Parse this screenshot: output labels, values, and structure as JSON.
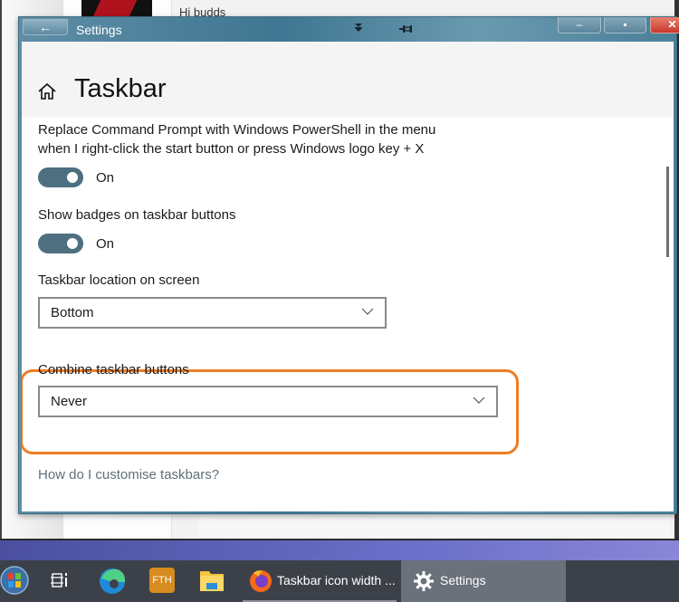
{
  "background": {
    "post_text": "Hi budds"
  },
  "window": {
    "title": "Settings",
    "back_label": "←",
    "icons": [
      "double-chevron-down-icon",
      "pin-icon"
    ],
    "controls": {
      "minimize": "–",
      "maximize": "▪",
      "close": "✕"
    }
  },
  "page": {
    "title": "Taskbar",
    "settings": [
      {
        "label_line1": "Replace Command Prompt with Windows PowerShell in the menu",
        "label_line2": "when I right-click the start button or press Windows logo key + X",
        "type": "toggle",
        "state": "On"
      },
      {
        "label": "Show badges on taskbar buttons",
        "type": "toggle",
        "state": "On"
      },
      {
        "label": "Taskbar location on screen",
        "type": "dropdown",
        "value": "Bottom"
      },
      {
        "label": "Combine taskbar buttons",
        "type": "dropdown",
        "value": "Never",
        "highlighted": true
      }
    ],
    "help_link": "How do I customise taskbars?"
  },
  "colors": {
    "toggle_on": "#4d6f80",
    "highlight": "#ef7d22",
    "link": "#5f6f7a"
  },
  "taskbar": {
    "items": [
      {
        "name": "start",
        "icon": "windows-orb-icon"
      },
      {
        "name": "task-view",
        "icon": "task-view-icon"
      },
      {
        "name": "edge",
        "icon": "edge-icon"
      },
      {
        "name": "fth",
        "icon": "fth-icon",
        "text": "FTH"
      },
      {
        "name": "file-explorer",
        "icon": "folder-icon"
      },
      {
        "name": "firefox",
        "icon": "firefox-icon",
        "label": "Taskbar icon width ..."
      },
      {
        "name": "settings",
        "icon": "gear-icon",
        "label": "Settings",
        "active": true
      }
    ]
  }
}
